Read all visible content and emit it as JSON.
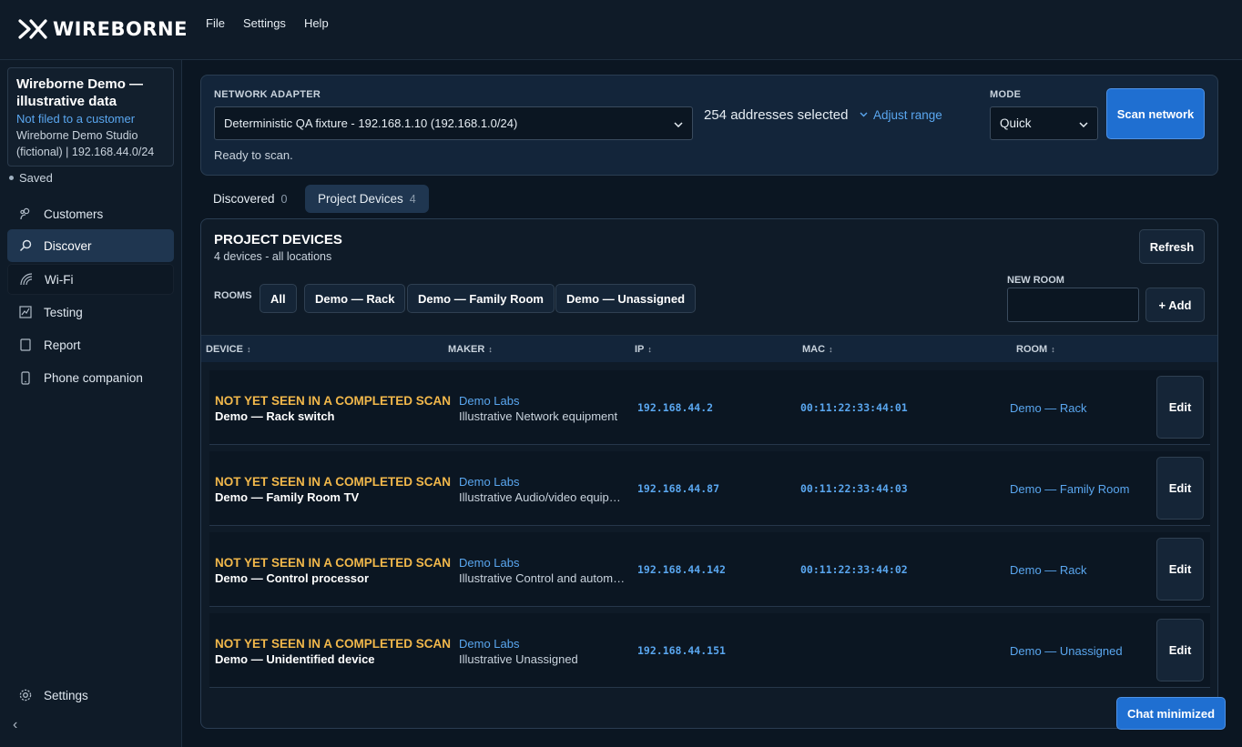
{
  "app": {
    "logo_text": "WIREBORNE"
  },
  "menu": {
    "file": "File",
    "settings": "Settings",
    "help": "Help"
  },
  "project": {
    "title": "Wireborne Demo — illustrative data",
    "customer_link": "Not filed to a customer",
    "org": "Wireborne Demo Studio (fictional) | 192.168.44.0/24",
    "save_status": "Saved"
  },
  "sidebar": {
    "items": [
      {
        "label": "Customers",
        "icon": "customers-icon"
      },
      {
        "label": "Discover",
        "icon": "search-icon",
        "active": true
      },
      {
        "label": "Wi-Fi",
        "icon": "wifi-icon"
      },
      {
        "label": "Testing",
        "icon": "chart-icon"
      },
      {
        "label": "Report",
        "icon": "document-icon"
      },
      {
        "label": "Phone companion",
        "icon": "phone-icon"
      }
    ],
    "settings_label": "Settings",
    "collapse_label": "‹"
  },
  "scan": {
    "adapter_label": "NETWORK ADAPTER",
    "adapter_value": "Deterministic QA fixture - 192.168.1.10 (192.168.1.0/24)",
    "addresses_selected": "254 addresses selected",
    "adjust_range": "Adjust range",
    "mode_label": "MODE",
    "mode_value": "Quick",
    "scan_button": "Scan network",
    "status": "Ready to scan."
  },
  "tabs": [
    {
      "label": "Discovered",
      "count": "0",
      "active": false
    },
    {
      "label": "Project Devices",
      "count": "4",
      "active": true
    }
  ],
  "devices": {
    "title": "PROJECT DEVICES",
    "subtitle": "4 devices - all locations",
    "refresh": "Refresh",
    "rooms_label": "ROOMS",
    "room_chips": [
      "All",
      "Demo — Rack",
      "Demo — Family Room",
      "Demo — Unassigned"
    ],
    "new_room_label": "NEW ROOM",
    "new_room_value": "",
    "add_button": "+ Add",
    "columns": [
      "DEVICE",
      "MAKER",
      "IP",
      "MAC",
      "ROOM"
    ],
    "rows": [
      {
        "warning": "NOT YET SEEN IN A COMPLETED SCAN",
        "name": "Demo — Rack switch",
        "maker": "Demo Labs",
        "maker_desc": "Illustrative Network equipment",
        "ip": "192.168.44.2",
        "mac": "00:11:22:33:44:01",
        "room": "Demo — Rack",
        "edit": "Edit"
      },
      {
        "warning": "NOT YET SEEN IN A COMPLETED SCAN",
        "name": "Demo — Family Room TV",
        "maker": "Demo Labs",
        "maker_desc": "Illustrative Audio/video equip…",
        "ip": "192.168.44.87",
        "mac": "00:11:22:33:44:03",
        "room": "Demo — Family Room",
        "edit": "Edit"
      },
      {
        "warning": "NOT YET SEEN IN A COMPLETED SCAN",
        "name": "Demo — Control processor",
        "maker": "Demo Labs",
        "maker_desc": "Illustrative Control and autom…",
        "ip": "192.168.44.142",
        "mac": "00:11:22:33:44:02",
        "room": "Demo — Rack",
        "edit": "Edit"
      },
      {
        "warning": "NOT YET SEEN IN A COMPLETED SCAN",
        "name": "Demo — Unidentified device",
        "maker": "Demo Labs",
        "maker_desc": "Illustrative Unassigned",
        "ip": "192.168.44.151",
        "mac": "",
        "room": "Demo — Unassigned",
        "edit": "Edit"
      }
    ]
  },
  "chat": {
    "label": "Chat minimized"
  },
  "colors": {
    "background": "#0b1622",
    "accent": "#1f6fd1",
    "link": "#5aa7f0",
    "warning": "#f2b84b"
  }
}
